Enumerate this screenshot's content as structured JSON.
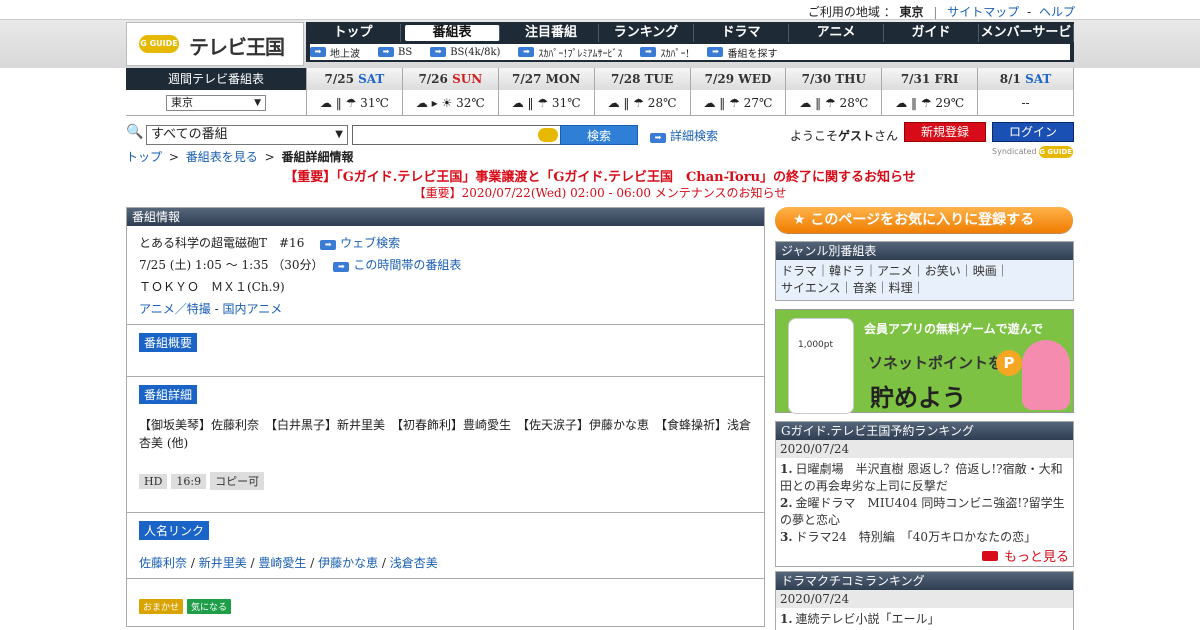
{
  "topbar": {
    "region_label": "ご利用の地域 ：",
    "region_value": "東京",
    "sitemap": "サイトマップ",
    "sep": "-",
    "help": "ヘルプ"
  },
  "logo": {
    "badge": "G GUIDE",
    "text": "テレビ王国"
  },
  "nav": {
    "tabs": [
      "トップ",
      "番組表",
      "注目番組",
      "ランキング",
      "ドラマ",
      "アニメ",
      "ガイド",
      "メンバーサービス"
    ],
    "sub": [
      "地上波",
      "BS",
      "BS(4k/8k)",
      "ｽｶﾊﾟｰ!ﾌﾟﾚﾐｱﾑｻｰﾋﾞｽ",
      "ｽｶﾊﾟｰ!",
      "番組を探す"
    ]
  },
  "week": {
    "label": "週間テレビ番組表",
    "region": "東京"
  },
  "days": [
    {
      "date": "7/25",
      "dow": "SAT",
      "kind": "sat",
      "wx": "☁ ‖ ☂ 31℃"
    },
    {
      "date": "7/26",
      "dow": "SUN",
      "kind": "sun",
      "wx": "☁ ▸ ☀ 32℃"
    },
    {
      "date": "7/27",
      "dow": "MON",
      "kind": "",
      "wx": "☁ ‖ ☂ 31℃"
    },
    {
      "date": "7/28",
      "dow": "TUE",
      "kind": "",
      "wx": "☁ ‖ ☂ 28℃"
    },
    {
      "date": "7/29",
      "dow": "WED",
      "kind": "",
      "wx": "☁ ‖ ☂ 27℃"
    },
    {
      "date": "7/30",
      "dow": "THU",
      "kind": "",
      "wx": "☁ ‖ ☂ 28℃"
    },
    {
      "date": "7/31",
      "dow": "FRI",
      "kind": "",
      "wx": "☁ ‖ ☂ 29℃"
    },
    {
      "date": "8/1",
      "dow": "SAT",
      "kind": "sat",
      "wx": "--"
    }
  ],
  "search": {
    "category": "すべての番組",
    "button": "検索",
    "advanced": "詳細検索"
  },
  "user": {
    "welcome_pre": "ようこそ",
    "guest": "ゲスト",
    "welcome_post": "さん",
    "register": "新規登録",
    "login": "ログイン"
  },
  "breadcrumb": {
    "top": "トップ",
    "sep": ">",
    "listing": "番組表を見る",
    "current": "番組詳細情報"
  },
  "syndicated": {
    "label": "Syndicated",
    "badge": "G GUIDE"
  },
  "notices": {
    "n1": "【重要】「Gガイド.テレビ王国」事業譲渡と「Gガイド.テレビ王国　Chan-Toru」の終了に関するお知らせ",
    "n2": "【重要】2020/07/22(Wed) 02:00 - 06:00 メンテナンスのお知らせ"
  },
  "program": {
    "panel_title": "番組情報",
    "title": "とある科学の超電磁砲T　#16",
    "web_search": "ウェブ検索",
    "time": "7/25 (土) 1:05 ～ 1:35 （30分）",
    "time_slot_link": "この時間帯の番組表",
    "channel": "ＴＯＫＹＯ　ＭＸ１(Ch.9)",
    "genre_main": "アニメ／特撮",
    "genre_dash": "-",
    "genre_sub": "国内アニメ",
    "summary_label": "番組概要",
    "detail_label": "番組詳細",
    "detail_text": "【御坂美琴】佐藤利奈　【白井黒子】新井里美　【初春飾利】豊崎愛生　【佐天涙子】伊藤かな恵　【食蜂操祈】浅倉杏美 (他)",
    "badges": [
      "HD",
      "16:9",
      "コピー可"
    ],
    "people_label": "人名リンク",
    "people": [
      "佐藤利奈",
      "新井里美",
      "豊崎愛生",
      "伊藤かな恵",
      "浅倉杏美"
    ],
    "people_sep": " / ",
    "mini_buttons": [
      "おまかせ",
      "気になる"
    ]
  },
  "side": {
    "fav": "★ このページをお気に入りに登録する",
    "genre_title": "ジャンル別番組表",
    "genre_line1": "ドラマ｜韓ドラ｜アニメ｜お笑い｜映画｜",
    "genre_line2": "サイエンス｜音楽｜料理｜",
    "ad_pt": "1,000pt",
    "ad_l1": "会員アプリの無料ゲームで遊んで",
    "ad_l2": "ソネットポイントを",
    "ad_l3": "貯めよう",
    "ad_coin": "P",
    "rank1_title": "Gガイド.テレビ王国予約ランキング",
    "rank1_date": "2020/07/24",
    "rank1_items": [
      "日曜劇場　半沢直樹 恩返し？倍返し!?宿敵・大和田との再会卑劣な上司に反撃だ",
      "金曜ドラマ　MIU404 同時コンビニ強盗!?留学生の夢と恋心",
      "ドラマ24　特別編　「40万キロかなたの恋」"
    ],
    "rank1_more": "もっと見る",
    "rank2_title": "ドラマクチコミランキング",
    "rank2_date": "2020/07/24",
    "rank2_items": [
      "連続テレビ小説「エール」"
    ]
  },
  "colors": {
    "accent": "#1a64c8",
    "alert": "#d80c18",
    "nav": "#1e2a36",
    "fav": "#f07d00"
  }
}
